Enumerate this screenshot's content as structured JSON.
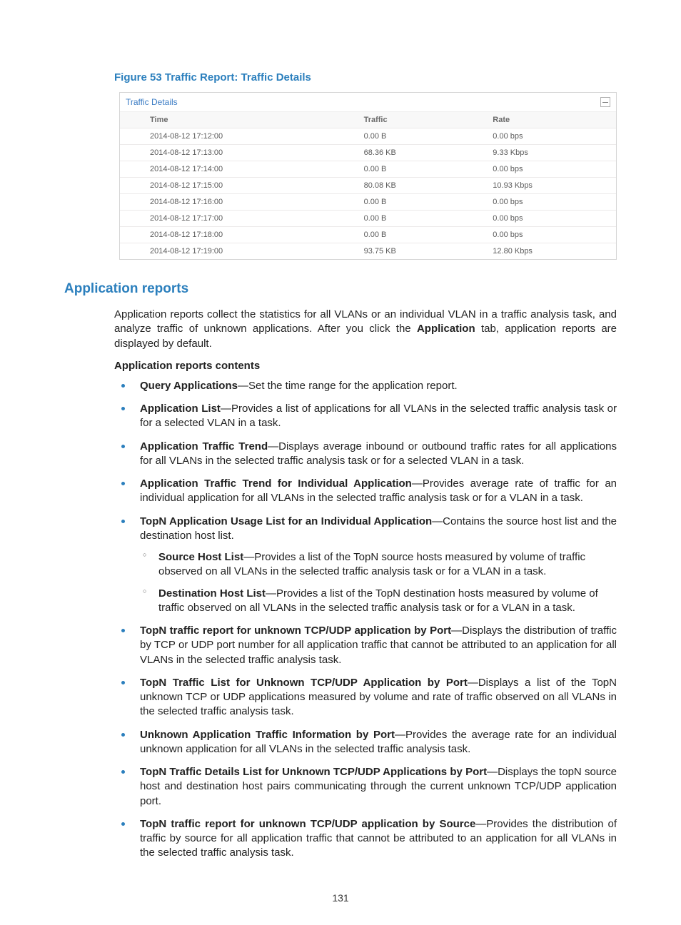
{
  "figure": {
    "caption": "Figure 53 Traffic Report: Traffic Details"
  },
  "panel": {
    "title": "Traffic Details",
    "columns": {
      "time": "Time",
      "traffic": "Traffic",
      "rate": "Rate"
    },
    "rows": [
      {
        "time": "2014-08-12 17:12:00",
        "traffic": "0.00 B",
        "rate": "0.00 bps"
      },
      {
        "time": "2014-08-12 17:13:00",
        "traffic": "68.36 KB",
        "rate": "9.33 Kbps"
      },
      {
        "time": "2014-08-12 17:14:00",
        "traffic": "0.00 B",
        "rate": "0.00 bps"
      },
      {
        "time": "2014-08-12 17:15:00",
        "traffic": "80.08 KB",
        "rate": "10.93 Kbps"
      },
      {
        "time": "2014-08-12 17:16:00",
        "traffic": "0.00 B",
        "rate": "0.00 bps"
      },
      {
        "time": "2014-08-12 17:17:00",
        "traffic": "0.00 B",
        "rate": "0.00 bps"
      },
      {
        "time": "2014-08-12 17:18:00",
        "traffic": "0.00 B",
        "rate": "0.00 bps"
      },
      {
        "time": "2014-08-12 17:19:00",
        "traffic": "93.75 KB",
        "rate": "12.80 Kbps"
      }
    ]
  },
  "section": {
    "heading": "Application reports",
    "intro_pre": "Application reports collect the statistics for all VLANs or an individual VLAN in a traffic analysis task, and analyze traffic of unknown applications. After you click the ",
    "intro_bold": "Application",
    "intro_post": " tab, application reports are displayed by default.",
    "contents_heading": "Application reports contents"
  },
  "bullets": [
    {
      "term": "Query Applications",
      "desc": "—Set the time range for the application report."
    },
    {
      "term": "Application List",
      "desc": "—Provides a list of applications for all VLANs in the selected traffic analysis task or for a selected VLAN in a task."
    },
    {
      "term": "Application Traffic Trend",
      "desc": "—Displays average inbound or outbound traffic rates for all applications for all VLANs in the selected traffic analysis task or for a selected VLAN in a task."
    },
    {
      "term": "Application Traffic Trend for Individual Application",
      "desc": "—Provides average rate of traffic for an individual application for all VLANs in the selected traffic analysis task or for a VLAN in a task."
    },
    {
      "term": "TopN Application Usage List for an Individual Application",
      "desc": "—Contains the source host list and the destination host list.",
      "sub": [
        {
          "term": "Source Host List",
          "desc": "—Provides a list of the TopN source hosts measured by volume of traffic observed on all VLANs in the selected traffic analysis task or for a VLAN in a task."
        },
        {
          "term": "Destination Host List",
          "desc": "—Provides a list of the TopN destination hosts measured by volume of traffic observed on all VLANs in the selected traffic analysis task or for a VLAN in a task."
        }
      ]
    },
    {
      "term": "TopN traffic report for unknown TCP/UDP application by Port",
      "desc": "—Displays the distribution of traffic by TCP or UDP port number for all application traffic that cannot be attributed to an application for all VLANs in the selected traffic analysis task."
    },
    {
      "term": "TopN Traffic List for Unknown TCP/UDP Application by Port",
      "desc": "—Displays a list of the TopN unknown TCP or UDP applications measured by volume and rate of traffic observed on all VLANs in the selected traffic analysis task."
    },
    {
      "term": "Unknown Application Traffic Information by Port",
      "desc": "—Provides the average rate for an individual unknown application for all VLANs in the selected traffic analysis task."
    },
    {
      "term": "TopN Traffic Details List for Unknown TCP/UDP Applications by Port",
      "desc": "—Displays the topN source host and destination host pairs communicating through the current unknown TCP/UDP application port."
    },
    {
      "term": "TopN traffic report for unknown TCP/UDP application by Source",
      "desc": "—Provides the distribution of traffic by source for all application traffic that cannot be attributed to an application for all VLANs in the selected traffic analysis task."
    }
  ],
  "page_number": "131"
}
